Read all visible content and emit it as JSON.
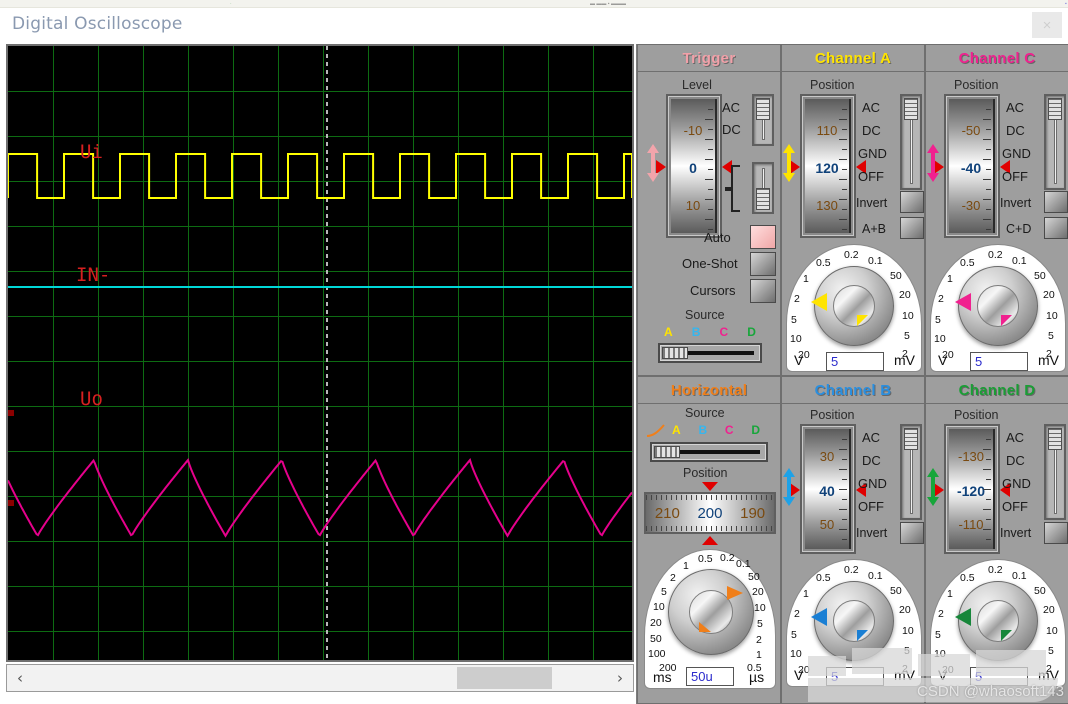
{
  "window": {
    "title": "Digital Oscilloscope",
    "close_label": "×"
  },
  "screen": {
    "labels": [
      {
        "text": "Ui",
        "color": "#d62020"
      },
      {
        "text": "IN-",
        "color": "#d62020"
      },
      {
        "text": "Uo",
        "color": "#d62020"
      }
    ],
    "traces": [
      {
        "name": "channel-a-trace",
        "label": "Ui",
        "color": "#ffff00",
        "shape": "square"
      },
      {
        "name": "channel-b-trace",
        "label": "IN-",
        "color": "#00d8d8",
        "shape": "flat"
      },
      {
        "name": "channel-c-trace",
        "label": "Uo",
        "color": "#e6008c",
        "shape": "ramp"
      }
    ],
    "grid_color": "#0d6b12",
    "background": "#000000"
  },
  "scrollbar": {
    "left_arrow": "‹",
    "right_arrow": "›"
  },
  "trigger": {
    "title": "Trigger",
    "title_color": "#f1a0a8",
    "level_label": "Level",
    "level_values": [
      "-10",
      "0",
      "10"
    ],
    "coupling": [
      "AC",
      "DC"
    ],
    "mode_buttons": [
      "Auto",
      "One-Shot",
      "Cursors"
    ],
    "source_label": "Source",
    "source_letters": [
      {
        "letter": "A",
        "color": "#ffe400"
      },
      {
        "letter": "B",
        "color": "#35b6ef"
      },
      {
        "letter": "C",
        "color": "#f0218f"
      },
      {
        "letter": "D",
        "color": "#17a63a"
      }
    ]
  },
  "horizontal": {
    "title": "Horizontal",
    "title_color": "#f07f1a",
    "source_label": "Source",
    "source_letters": [
      {
        "letter": "A",
        "color": "#ffe400"
      },
      {
        "letter": "B",
        "color": "#35b6ef"
      },
      {
        "letter": "C",
        "color": "#f0218f"
      },
      {
        "letter": "D",
        "color": "#17a63a"
      }
    ],
    "position_label": "Position",
    "position_values": [
      "210",
      "200",
      "190"
    ],
    "dial": {
      "left_labels": [
        "0.5",
        "0.2",
        "0.1",
        "1",
        "2",
        "5",
        "10",
        "20",
        "50",
        "100",
        "200"
      ],
      "right_labels": [
        "50",
        "20",
        "10",
        "5",
        "2",
        "1",
        "0.5"
      ],
      "left_unit": "ms",
      "right_unit": "µs",
      "value": "50u",
      "pointer_color": "#f07f1a"
    }
  },
  "channel_a": {
    "title": "Channel A",
    "title_color": "#ffe400",
    "position_label": "Position",
    "position_values": [
      "110",
      "120",
      "130"
    ],
    "coupling": [
      "AC",
      "DC",
      "GND",
      "OFF"
    ],
    "buttons": [
      "Invert",
      "A+B"
    ],
    "dial": {
      "left_labels": [
        "0.5",
        "0.2",
        "0.1",
        "1",
        "2",
        "5",
        "10",
        "20"
      ],
      "right_labels": [
        "50",
        "20",
        "10",
        "5",
        "2"
      ],
      "left_unit": "V",
      "right_unit": "mV",
      "value": "5",
      "pointer_color": "#ffe400"
    }
  },
  "channel_b": {
    "title": "Channel B",
    "title_color": "#2a8fe0",
    "position_label": "Position",
    "position_values": [
      "30",
      "40",
      "50"
    ],
    "coupling": [
      "AC",
      "DC",
      "GND",
      "OFF"
    ],
    "buttons": [
      "Invert"
    ],
    "dial": {
      "left_labels": [
        "0.5",
        "0.2",
        "0.1",
        "1",
        "2",
        "5",
        "10",
        "20"
      ],
      "right_labels": [
        "50",
        "20",
        "10",
        "5",
        "2"
      ],
      "left_unit": "V",
      "right_unit": "mV",
      "value": "5",
      "pointer_color": "#1a7fd4"
    }
  },
  "channel_c": {
    "title": "Channel C",
    "title_color": "#f0218f",
    "position_label": "Position",
    "position_values": [
      "-50",
      "-40",
      "-30"
    ],
    "coupling": [
      "AC",
      "DC",
      "GND",
      "OFF"
    ],
    "buttons": [
      "Invert",
      "C+D"
    ],
    "dial": {
      "left_labels": [
        "0.5",
        "0.2",
        "0.1",
        "1",
        "2",
        "5",
        "10",
        "20"
      ],
      "right_labels": [
        "50",
        "20",
        "10",
        "5",
        "2"
      ],
      "left_unit": "V",
      "right_unit": "mV",
      "value": "5",
      "pointer_color": "#f0218f"
    }
  },
  "channel_d": {
    "title": "Channel D",
    "title_color": "#1a9e35",
    "position_label": "Position",
    "position_values": [
      "-130",
      "-120",
      "-110"
    ],
    "coupling": [
      "AC",
      "DC",
      "GND",
      "OFF"
    ],
    "buttons": [
      "Invert"
    ],
    "dial": {
      "left_labels": [
        "0.5",
        "0.2",
        "0.1",
        "1",
        "2",
        "5",
        "10",
        "20"
      ],
      "right_labels": [
        "50",
        "20",
        "10",
        "5",
        "2"
      ],
      "left_unit": "V",
      "right_unit": "mV",
      "value": "5",
      "pointer_color": "#1a9e35"
    }
  },
  "watermark": {
    "text": "CSDN @whaosoft143"
  }
}
